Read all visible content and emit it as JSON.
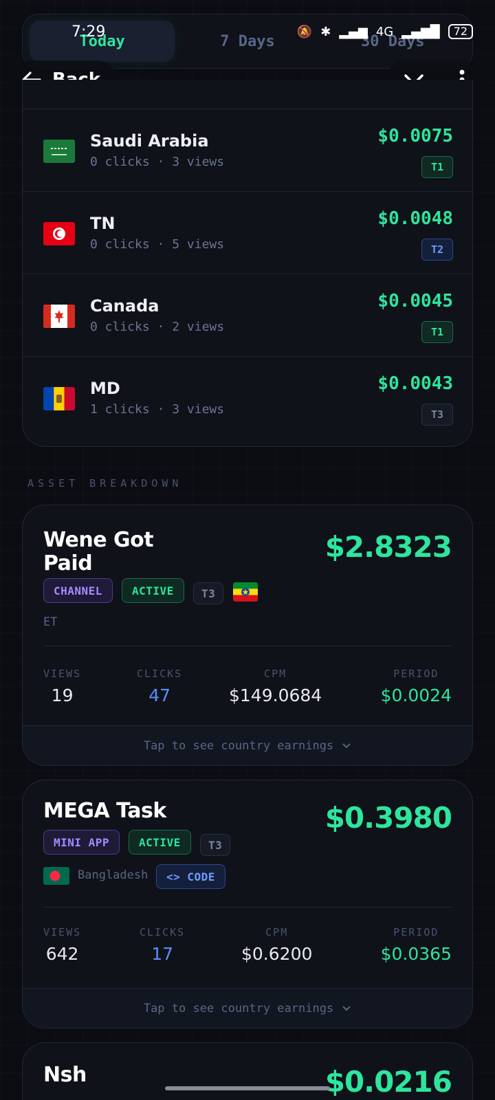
{
  "status_bar": {
    "time": "7:29",
    "network": "4G",
    "battery": "72"
  },
  "period_tabs": [
    {
      "label": "Today",
      "active": true
    },
    {
      "label": "7 Days",
      "active": false
    },
    {
      "label": "30 Days",
      "active": false
    }
  ],
  "nav": {
    "back_label": "Back"
  },
  "countries": [
    {
      "name": "Saudi Arabia",
      "clicks": "0 clicks",
      "views": "3 views",
      "amount": "$0.0075",
      "tier": "T1"
    },
    {
      "name": "TN",
      "clicks": "0 clicks",
      "views": "5 views",
      "amount": "$0.0048",
      "tier": "T2"
    },
    {
      "name": "Canada",
      "clicks": "0 clicks",
      "views": "2 views",
      "amount": "$0.0045",
      "tier": "T1"
    },
    {
      "name": "MD",
      "clicks": "1 clicks",
      "views": "3 views",
      "amount": "$0.0043",
      "tier": "T3"
    }
  ],
  "section_label": "ASSET BREAKDOWN",
  "stat_labels": {
    "views": "VIEWS",
    "clicks": "CLICKS",
    "cpm": "CPM",
    "period": "PERIOD"
  },
  "assets": [
    {
      "title_line1": "Wene Got",
      "title_line2": "Paid",
      "amount": "$2.8323",
      "type": "CHANNEL",
      "status": "ACTIVE",
      "tier": "T3",
      "country_code": "ET",
      "views": "19",
      "clicks": "47",
      "cpm": "$149.0684",
      "period": "$0.0024",
      "tap_text": "Tap to see country earnings"
    },
    {
      "title_line1": "MEGA Task",
      "amount": "$0.3980",
      "type": "MINI APP",
      "status": "ACTIVE",
      "tier": "T3",
      "country": "Bangladesh",
      "code_label": "<> CODE",
      "views": "642",
      "clicks": "17",
      "cpm": "$0.6200",
      "period": "$0.0365",
      "tap_text": "Tap to see country earnings"
    },
    {
      "title_line1": "Nsh",
      "amount": "$0.0216"
    }
  ],
  "colors": {
    "accent_green": "#2ee59d",
    "accent_blue": "#5b8dff",
    "background": "#0b0d12"
  }
}
